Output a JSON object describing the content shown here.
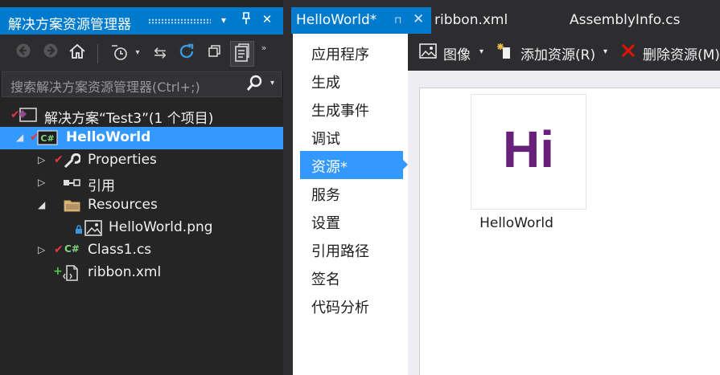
{
  "solution_explorer": {
    "title": "解决方案资源管理器",
    "title_buttons": {
      "dropdown": "▾",
      "pin": "⊓",
      "close": "✕"
    },
    "search_placeholder": "搜索解决方案资源管理器(Ctrl+;)",
    "tree": [
      {
        "label": "解决方案“Test3”(1 个项目)",
        "icon": "solution-icon"
      },
      {
        "label": "HelloWorld",
        "icon": "csharp-project-icon",
        "selected": true
      },
      {
        "label": "Properties",
        "icon": "wrench-icon"
      },
      {
        "label": "引用",
        "icon": "references-icon"
      },
      {
        "label": "Resources",
        "icon": "folder-icon"
      },
      {
        "label": "HelloWorld.png",
        "icon": "image-file-icon"
      },
      {
        "label": "Class1.cs",
        "icon": "csharp-file-icon"
      },
      {
        "label": "ribbon.xml",
        "icon": "xml-file-icon"
      }
    ],
    "glyphs": {
      "cs": "C#"
    }
  },
  "editor_tabs": [
    {
      "label": "HelloWorld*",
      "active": true
    },
    {
      "label": "ribbon.xml",
      "active": false
    },
    {
      "label": "AssemblyInfo.cs",
      "active": false
    }
  ],
  "project_nav": [
    {
      "label": "应用程序"
    },
    {
      "label": "生成"
    },
    {
      "label": "生成事件"
    },
    {
      "label": "调试"
    },
    {
      "label": "资源*",
      "selected": true
    },
    {
      "label": "服务"
    },
    {
      "label": "设置"
    },
    {
      "label": "引用路径"
    },
    {
      "label": "签名"
    },
    {
      "label": "代码分析"
    }
  ],
  "resource_toolbar": {
    "image_label": "图像",
    "add_label": "添加资源(R)",
    "delete_label": "删除资源(M)"
  },
  "resource_item": {
    "thumbnail_text": "Hi",
    "name": "HelloWorld",
    "thumbnail_color": "#68217a"
  },
  "colors": {
    "accent": "#007acc",
    "selection": "#3399ff"
  }
}
